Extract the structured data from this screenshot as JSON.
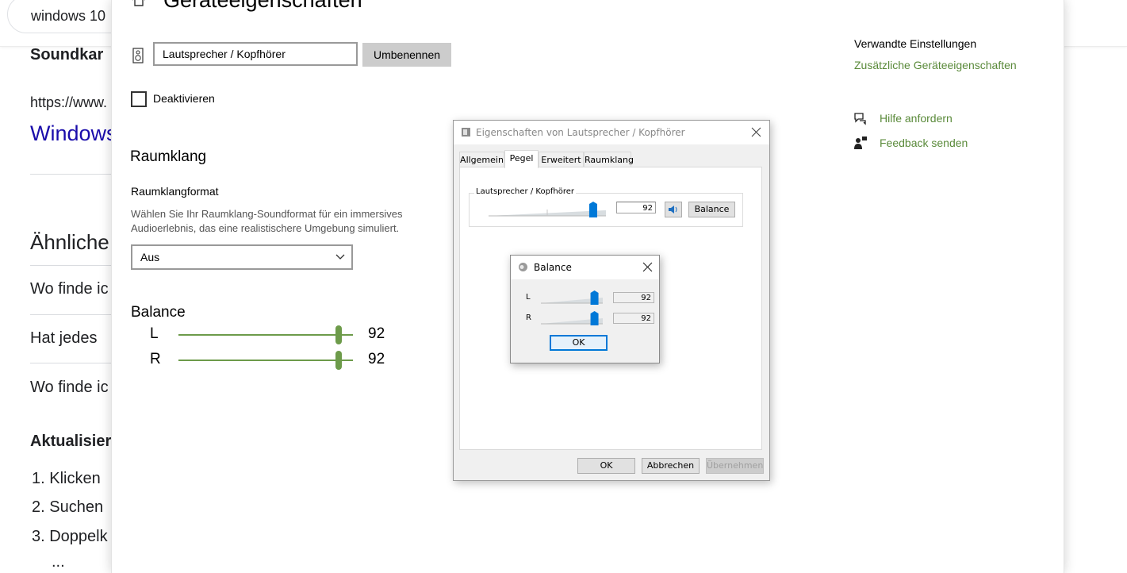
{
  "background_page": {
    "search_text": "windows 10",
    "heading_1": "Soundkar",
    "url": "https://www.",
    "link": "Windows",
    "related_heading": "Ähnliche",
    "q1": "Wo finde ic",
    "q2": "Hat jedes",
    "q3": "Wo finde ic",
    "heading_2": "Aktualisier",
    "steps": [
      "1. Klicken",
      "2. Suchen",
      "3. Doppelk"
    ],
    "ellipsis": "..."
  },
  "settings": {
    "page_title": "Geräteeigenschaften",
    "device_name": "Lautsprecher / Kopfhörer",
    "rename_label": "Umbenennen",
    "disable_label": "Deaktivieren",
    "spatial_title": "Raumklang",
    "spatial_format_label": "Raumklangformat",
    "spatial_description": "Wählen Sie Ihr Raumklang-Soundformat für ein immersives Audioerlebnis, das eine realistischere Umgebung simuliert.",
    "spatial_selected": "Aus",
    "balance_title": "Balance",
    "balance": {
      "left_label": "L",
      "left_value": "92",
      "left_level": 92,
      "right_label": "R",
      "right_value": "92",
      "right_level": 92
    },
    "related_heading": "Verwandte Einstellungen",
    "additional_props_link": "Zusätzliche Geräteeigenschaften",
    "help_link": "Hilfe anfordern",
    "feedback_link": "Feedback senden",
    "accent_color": "#5a8a3a"
  },
  "properties_dialog": {
    "title": "Eigenschaften von Lautsprecher / Kopfhörer",
    "tabs": [
      "Allgemein",
      "Pegel",
      "Erweitert",
      "Raumklang"
    ],
    "active_tab": "Pegel",
    "group_label": "Lautsprecher / Kopfhörer",
    "level_value": "92",
    "level": 92,
    "balance_button": "Balance",
    "ok": "OK",
    "cancel": "Abbrechen",
    "apply": "Übernehmen"
  },
  "balance_dialog": {
    "title": "Balance",
    "left_label": "L",
    "left_value": "92",
    "left_level": 92,
    "right_label": "R",
    "right_value": "92",
    "right_level": 92,
    "ok": "OK"
  }
}
